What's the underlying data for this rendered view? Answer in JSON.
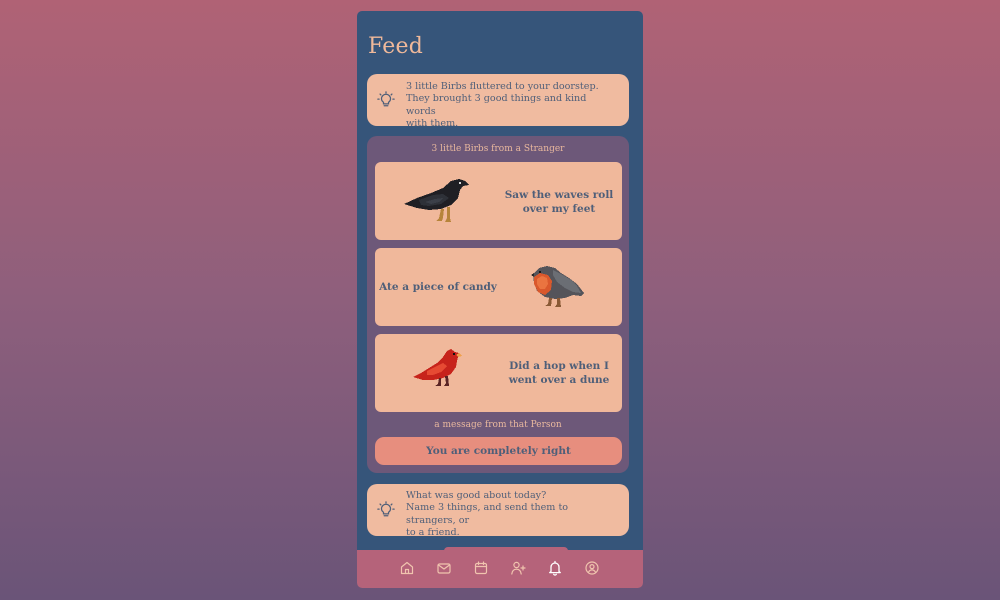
{
  "page": {
    "title": "Feed"
  },
  "notifications": [
    {
      "icon": "lightbulb-icon",
      "text_lines": [
        "3 little Birbs fluttered to your doorstep.",
        "They brought 3 good things and kind words",
        "with them."
      ]
    },
    {
      "icon": "lightbulb-icon",
      "text_lines": [
        "What was good about today?",
        "Name 3 things, and send them to strangers, or",
        "to a friend."
      ]
    }
  ],
  "gift": {
    "heading": "3 little Birbs from a Stranger",
    "cards": [
      {
        "lines": [
          "Saw the waves roll",
          "over my feet"
        ],
        "birb": "crow-icon"
      },
      {
        "lines": [
          "Ate a piece of candy"
        ],
        "birb": "robin-icon"
      },
      {
        "lines": [
          "Did a hop when I",
          "went over a dune"
        ],
        "birb": "cardinal-icon"
      }
    ],
    "message_heading": "a message from that Person",
    "message": "You are completely right"
  },
  "nav": {
    "items": [
      {
        "icon": "home-icon"
      },
      {
        "icon": "mail-icon"
      },
      {
        "icon": "calendar-icon"
      },
      {
        "icon": "add-user-icon"
      },
      {
        "icon": "bell-icon",
        "active": true
      },
      {
        "icon": "profile-icon"
      }
    ]
  },
  "colors": {
    "background_top": "#b06275",
    "background_bottom": "#6a5478",
    "app_background": "#36557a",
    "card": "#f0bba0",
    "gift_panel": "#6d5879",
    "reply_button": "#e78e7e",
    "nav_bar": "#b5637a",
    "text": "#4f5f79",
    "accent_text": "#f0b99a"
  }
}
